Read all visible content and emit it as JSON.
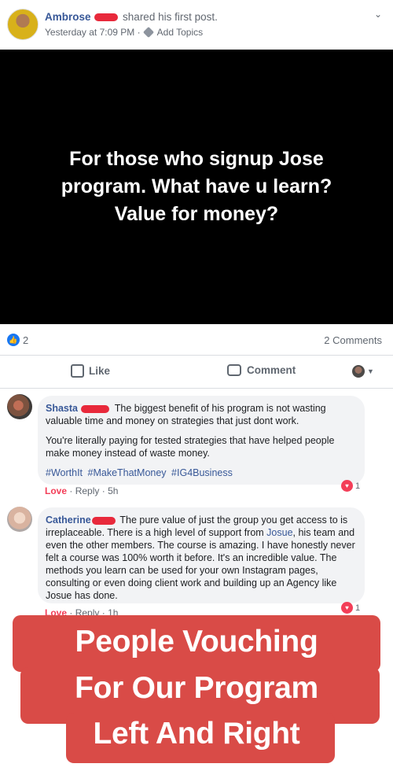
{
  "post": {
    "author": "Ambrose",
    "action_text": "shared his first post.",
    "time": "Yesterday at 7:09 PM",
    "separator": "·",
    "add_topics": "Add Topics",
    "image_text_lines": [
      "For those who signup Jose",
      "program. What have u learn?",
      "Value for money?"
    ]
  },
  "reactions": {
    "like_count": "2",
    "comments_label": "2 Comments"
  },
  "actions": {
    "like": "Like",
    "comment": "Comment"
  },
  "comments": [
    {
      "name": "Shasta",
      "lead": "The biggest benefit of his program is not wasting valuable time and money on strategies that just dont work.",
      "para2": "You're literally paying for tested strategies that have helped people make money instead of waste money.",
      "hashtags": [
        "#WorthIt",
        "#MakeThatMoney",
        "#IG4Business"
      ],
      "love": "Love",
      "reply": "Reply",
      "age": "5h",
      "reaction_count": "1"
    },
    {
      "name": "Catherine",
      "text_before": "The pure value of just the group you get access to is irreplaceable. There is a high level of support from ",
      "mention": "Josue",
      "text_after": ", his team and even the other members. The course is amazing. I have honestly never felt a course was 100% worth it before. It's an incredible value. The methods you learn can be used for your own Instagram pages, consulting or even doing client work and building up an Agency like Josue has done.",
      "love": "Love",
      "reply": "Reply",
      "age": "1h",
      "reaction_count": "1"
    }
  ],
  "overlay": {
    "lines": [
      "People Vouching",
      "For Our Program",
      "Left And Right"
    ],
    "color": "#d94b47"
  },
  "colors": {
    "link": "#385898",
    "love": "#f33e58",
    "like_blue": "#1877f2"
  }
}
